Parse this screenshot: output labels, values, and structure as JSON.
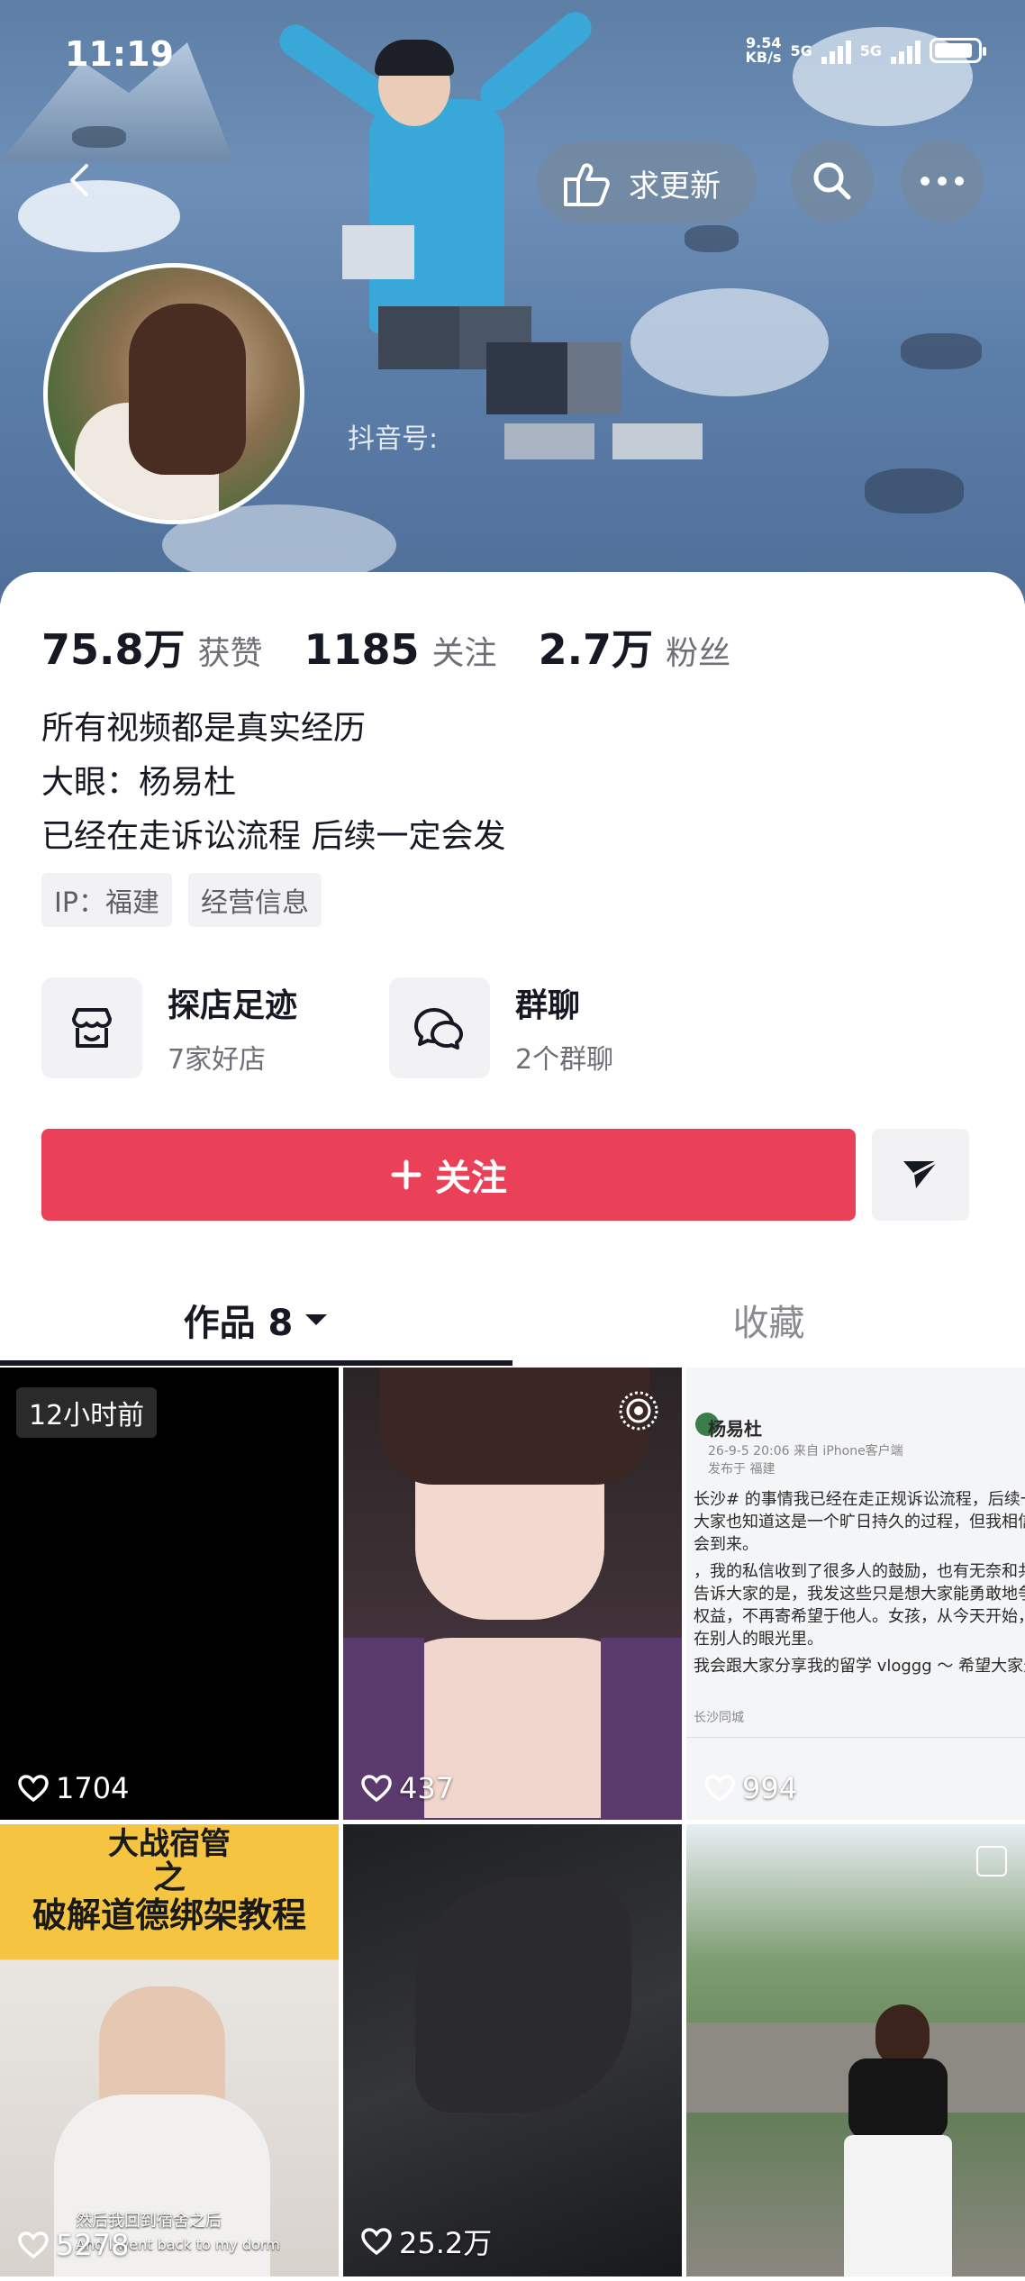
{
  "status_bar": {
    "time": "11:19",
    "net_speed": "9.54",
    "net_unit": "KB/s",
    "net_type_1": "5G",
    "net_type_2": "5G"
  },
  "header": {
    "update_button_label": "求更新",
    "douyin_id_label": "抖音号:"
  },
  "stats": [
    {
      "value": "75.8万",
      "label": "获赞"
    },
    {
      "value": "1185",
      "label": "关注"
    },
    {
      "value": "2.7万",
      "label": "粉丝"
    }
  ],
  "bio": [
    "所有视频都是真实经历",
    "大眼：杨易杜",
    "已经在走诉讼流程 后续一定会发"
  ],
  "tags": [
    "IP：福建",
    "经营信息"
  ],
  "features": [
    {
      "title": "探店足迹",
      "sub": "7家好店",
      "icon": "shop-icon"
    },
    {
      "title": "群聊",
      "sub": "2个群聊",
      "icon": "chat-icon"
    }
  ],
  "follow_button_label": "关注",
  "tabs": {
    "works": "作品 8",
    "favorites": "收藏"
  },
  "videos": [
    {
      "likes": "1704",
      "badge": "12小时前"
    },
    {
      "likes": "437"
    },
    {
      "likes": "994",
      "doc_author": "杨易杜",
      "doc_meta": "26-9-5 20:06 来自 iPhone客户端",
      "doc_meta2": "发布于 福建",
      "doc_lines": [
        "长沙# 的事情我已经在走正规诉讼流程，后续一定会",
        "大家也知道这是一个旷日持久的过程，但我相信正",
        "会到来。",
        "，我的私信收到了很多人的鼓励，也有无奈和共鸣",
        "告诉大家的是，我发这些只是想大家能勇敢地争取",
        "权益，不再寄希望于他人。女孩，从今天开始，不",
        "在别人的眼光里。",
        "我会跟大家分享我的留学 vloggg ～ 希望大家天天"
      ],
      "doc_location": "长沙同城"
    },
    {
      "likes": "5278",
      "poster_line1": "大战宿管",
      "poster_line2": "之",
      "poster_line3": "破解道德绑架教程",
      "caption_cn": "然后我回到宿舍之后",
      "caption_en": "And I went back to my dorm"
    },
    {
      "likes": "25.2万"
    },
    {
      "likes": ""
    }
  ]
}
